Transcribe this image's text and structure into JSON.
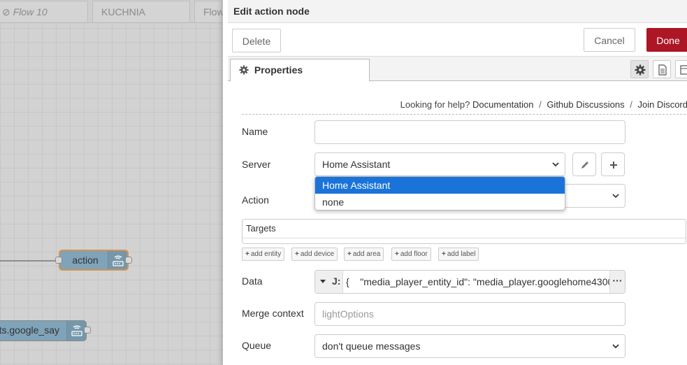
{
  "workspace": {
    "tabs": [
      {
        "label": "Flow 10",
        "disabled": true
      },
      {
        "label": "KUCHNIA"
      },
      {
        "label": "Flow"
      }
    ],
    "nodes": [
      {
        "label": "action"
      },
      {
        "label": "ts.google_say"
      }
    ]
  },
  "editor": {
    "title": "Edit action node",
    "delete_label": "Delete",
    "cancel_label": "Cancel",
    "done_label": "Done",
    "tab_properties": "Properties",
    "help": {
      "prefix": "Looking for help?",
      "links": [
        "Documentation",
        "Github Discussions",
        "Join Discord"
      ],
      "separator": "/"
    },
    "fields": {
      "name_label": "Name",
      "name_value": "",
      "server_label": "Server",
      "server_value": "Home Assistant",
      "server_options": [
        "Home Assistant",
        "none"
      ],
      "action_label": "Action",
      "targets_label": "Targets",
      "target_buttons": [
        "add entity",
        "add device",
        "add area",
        "add floor",
        "add label"
      ],
      "data_label": "Data",
      "data_value": "{    \"media_player_entity_id\": \"media_player.googlehome4300",
      "merge_label": "Merge context",
      "merge_placeholder": "lightOptions",
      "queue_label": "Queue",
      "queue_value": "don't queue messages"
    }
  },
  "colors": {
    "done_button": "#ad1625",
    "selected_option": "#1a73d9",
    "node_fill": "#7fa3b8",
    "node_selected_border": "#d9924a"
  }
}
